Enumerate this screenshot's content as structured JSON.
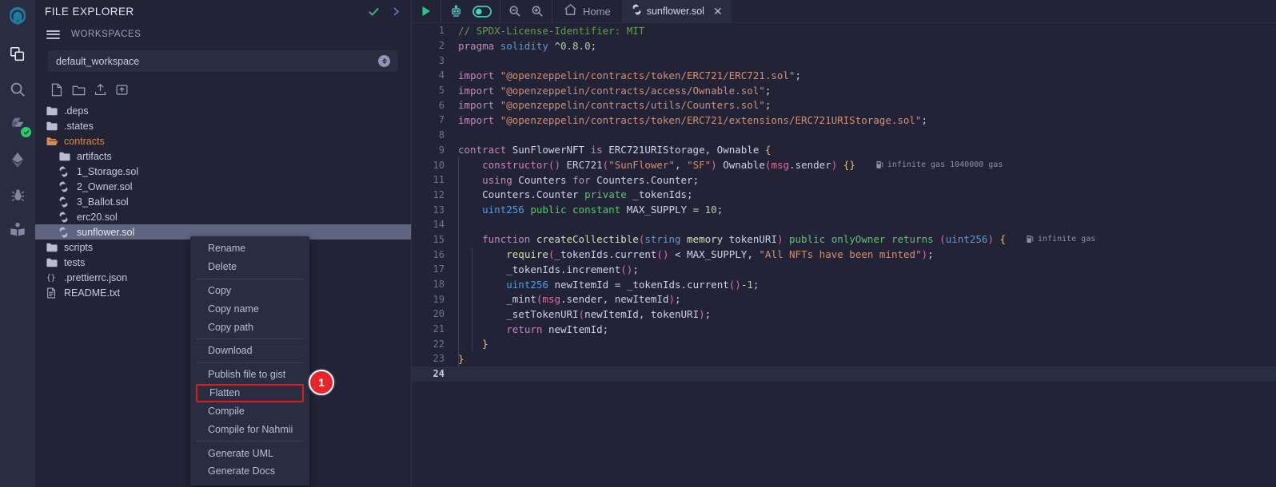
{
  "app": {
    "name": "remix-ide",
    "theme_bg": "#222336",
    "panel_bg": "#2a2c3f"
  },
  "rail": {
    "items": [
      {
        "name": "remix-logo",
        "label": "Remix"
      },
      {
        "name": "file-explorer-icon",
        "label": "File explorer"
      },
      {
        "name": "search-icon",
        "label": "Search in files"
      },
      {
        "name": "solidity-compiler-icon",
        "label": "Solidity compiler"
      },
      {
        "name": "deploy-run-icon",
        "label": "Deploy & run transactions"
      },
      {
        "name": "debugger-icon",
        "label": "Debugger"
      },
      {
        "name": "plugin-manager-icon",
        "label": "Plugin manager"
      }
    ]
  },
  "explorer": {
    "title": "FILE EXPLORER",
    "header_icons": [
      "check-icon",
      "chevron-right-icon"
    ],
    "workspaces_label": "WORKSPACES",
    "workspace_selected": "default_workspace",
    "toolbar_icons": [
      "new-file-icon",
      "new-folder-icon",
      "upload-file-icon",
      "upload-folder-icon"
    ],
    "tree": [
      {
        "label": ".deps",
        "icon": "folder-icon",
        "depth": 0,
        "state": "closed",
        "selected": false
      },
      {
        "label": ".states",
        "icon": "folder-icon",
        "depth": 0,
        "state": "closed",
        "selected": false
      },
      {
        "label": "contracts",
        "icon": "folder-open-icon",
        "depth": 0,
        "state": "open",
        "selected": false
      },
      {
        "label": "artifacts",
        "icon": "folder-icon",
        "depth": 1,
        "state": "closed",
        "selected": false
      },
      {
        "label": "1_Storage.sol",
        "icon": "solidity-icon",
        "depth": 1,
        "state": "file",
        "selected": false
      },
      {
        "label": "2_Owner.sol",
        "icon": "solidity-icon",
        "depth": 1,
        "state": "file",
        "selected": false
      },
      {
        "label": "3_Ballot.sol",
        "icon": "solidity-icon",
        "depth": 1,
        "state": "file",
        "selected": false
      },
      {
        "label": "erc20.sol",
        "icon": "solidity-icon",
        "depth": 1,
        "state": "file",
        "selected": false
      },
      {
        "label": "sunflower.sol",
        "icon": "solidity-icon",
        "depth": 1,
        "state": "file",
        "selected": true
      },
      {
        "label": "scripts",
        "icon": "folder-icon",
        "depth": 0,
        "state": "closed",
        "selected": false
      },
      {
        "label": "tests",
        "icon": "folder-icon",
        "depth": 0,
        "state": "closed",
        "selected": false
      },
      {
        "label": ".prettierrc.json",
        "icon": "json-icon",
        "depth": 0,
        "state": "file",
        "selected": false
      },
      {
        "label": "README.txt",
        "icon": "text-file-icon",
        "depth": 0,
        "state": "file",
        "selected": false
      }
    ]
  },
  "context_menu": {
    "items": [
      {
        "label": "Rename",
        "sep_after": false,
        "highlighted": false
      },
      {
        "label": "Delete",
        "sep_after": true,
        "highlighted": false
      },
      {
        "label": "Copy",
        "sep_after": false,
        "highlighted": false
      },
      {
        "label": "Copy name",
        "sep_after": false,
        "highlighted": false
      },
      {
        "label": "Copy path",
        "sep_after": true,
        "highlighted": false
      },
      {
        "label": "Download",
        "sep_after": true,
        "highlighted": false
      },
      {
        "label": "Publish file to gist",
        "sep_after": false,
        "highlighted": false
      },
      {
        "label": "Flatten",
        "sep_after": false,
        "highlighted": true
      },
      {
        "label": "Compile",
        "sep_after": false,
        "highlighted": false
      },
      {
        "label": "Compile for Nahmii",
        "sep_after": true,
        "highlighted": false
      },
      {
        "label": "Generate UML",
        "sep_after": false,
        "highlighted": false
      },
      {
        "label": "Generate Docs",
        "sep_after": false,
        "highlighted": false
      }
    ],
    "marker": {
      "number": "1",
      "color": "#e6252a"
    }
  },
  "editor_toolbar": {
    "run_icon": "play-icon",
    "script_runner_icon": "robot-icon",
    "toggle_icon": "toggle-on-icon",
    "zoom_out_icon": "zoom-out-icon",
    "zoom_in_icon": "zoom-in-icon",
    "home_icon": "home-icon",
    "home_label": "Home",
    "tab": {
      "label": "sunflower.sol",
      "icon": "solidity-icon",
      "close_icon": "close-icon",
      "active": true
    }
  },
  "code": {
    "language": "solidity",
    "active_line": 24,
    "lines": [
      {
        "n": 1,
        "text": "// SPDX-License-Identifier: MIT"
      },
      {
        "n": 2,
        "text": "pragma solidity ^0.8.0;"
      },
      {
        "n": 3,
        "text": ""
      },
      {
        "n": 4,
        "text": "import \"@openzeppelin/contracts/token/ERC721/ERC721.sol\";"
      },
      {
        "n": 5,
        "text": "import \"@openzeppelin/contracts/access/Ownable.sol\";"
      },
      {
        "n": 6,
        "text": "import \"@openzeppelin/contracts/utils/Counters.sol\";"
      },
      {
        "n": 7,
        "text": "import \"@openzeppelin/contracts/token/ERC721/extensions/ERC721URIStorage.sol\";"
      },
      {
        "n": 8,
        "text": ""
      },
      {
        "n": 9,
        "text": "contract SunFlowerNFT is ERC721URIStorage, Ownable {"
      },
      {
        "n": 10,
        "text": "    constructor() ERC721(\"SunFlower\", \"SF\") Ownable(msg.sender) {}",
        "gas": "infinite gas 1040000 gas"
      },
      {
        "n": 11,
        "text": "    using Counters for Counters.Counter;"
      },
      {
        "n": 12,
        "text": "    Counters.Counter private _tokenIds;"
      },
      {
        "n": 13,
        "text": "    uint256 public constant MAX_SUPPLY = 10;"
      },
      {
        "n": 14,
        "text": ""
      },
      {
        "n": 15,
        "text": "    function createCollectible(string memory tokenURI) public onlyOwner returns (uint256) {",
        "gas": "infinite gas"
      },
      {
        "n": 16,
        "text": "        require(_tokenIds.current() < MAX_SUPPLY, \"All NFTs have been minted\");"
      },
      {
        "n": 17,
        "text": "        _tokenIds.increment();"
      },
      {
        "n": 18,
        "text": "        uint256 newItemId = _tokenIds.current()-1;"
      },
      {
        "n": 19,
        "text": "        _mint(msg.sender, newItemId);"
      },
      {
        "n": 20,
        "text": "        _setTokenURI(newItemId, tokenURI);"
      },
      {
        "n": 21,
        "text": "        return newItemId;"
      },
      {
        "n": 22,
        "text": "    }"
      },
      {
        "n": 23,
        "text": "}"
      },
      {
        "n": 24,
        "text": ""
      }
    ]
  }
}
